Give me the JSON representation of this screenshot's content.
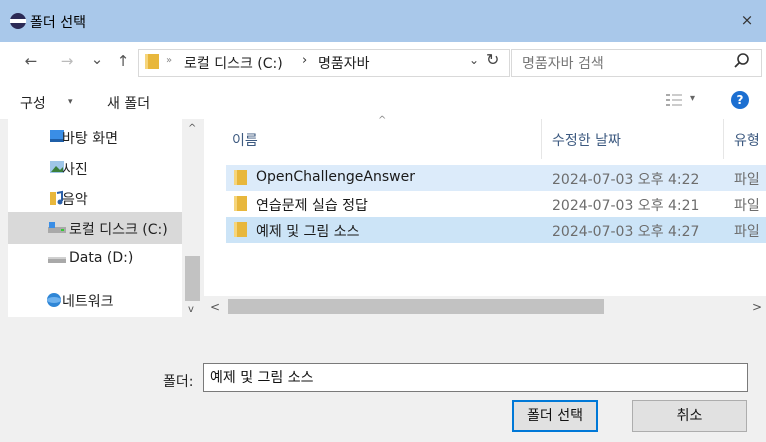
{
  "window": {
    "title": "폴더 선택",
    "close_glyph": "×"
  },
  "address": {
    "back_glyph": "←",
    "forward_glyph": "→",
    "recent_glyph": "⌄",
    "up_glyph": "↑",
    "chevron1": "»",
    "path_root": "로컬 디스크 (C:)",
    "chevron2": "›",
    "path_current": "명품자바",
    "dropdown_glyph": "⌄",
    "refresh_glyph": "↻"
  },
  "search": {
    "placeholder": "명품자바 검색"
  },
  "toolbar": {
    "organize": "구성",
    "organize_arrow": "▾",
    "new_folder": "새 폴더",
    "view_arrow": "▾",
    "help": "?"
  },
  "nav": {
    "items": [
      {
        "label": "바탕 화면",
        "icon": "desktop-icon"
      },
      {
        "label": "사진",
        "icon": "pictures-icon"
      },
      {
        "label": "음악",
        "icon": "music-icon"
      },
      {
        "label": "로컬 디스크 (C:)",
        "icon": "drive-icon",
        "selected": true
      },
      {
        "label": "Data (D:)",
        "icon": "drive-icon"
      },
      {
        "label": "네트워크",
        "icon": "network-icon"
      }
    ],
    "scroll_up": "^",
    "scroll_down": "v"
  },
  "files": {
    "columns": {
      "name": "이름",
      "date": "수정한 날짜",
      "type": "유형"
    },
    "sort_glyph": "^",
    "rows": [
      {
        "name": "OpenChallengeAnswer",
        "date": "2024-07-03 오후 4:22",
        "type": "파일"
      },
      {
        "name": "연습문제 실습 정답",
        "date": "2024-07-03 오후 4:21",
        "type": "파일"
      },
      {
        "name": "예제 및 그림 소스",
        "date": "2024-07-03 오후 4:27",
        "type": "파일"
      }
    ],
    "scroll_left": "<",
    "scroll_right": ">"
  },
  "footer": {
    "folder_label": "폴더:",
    "folder_value": "예제 및 그림 소스",
    "select_button": "폴더 선택",
    "cancel_button": "취소"
  },
  "colors": {
    "titlebar": "#a9c8ea",
    "accent": "#0078d7",
    "folder": "#e8b73c",
    "selected_row": "#cce4f7"
  }
}
